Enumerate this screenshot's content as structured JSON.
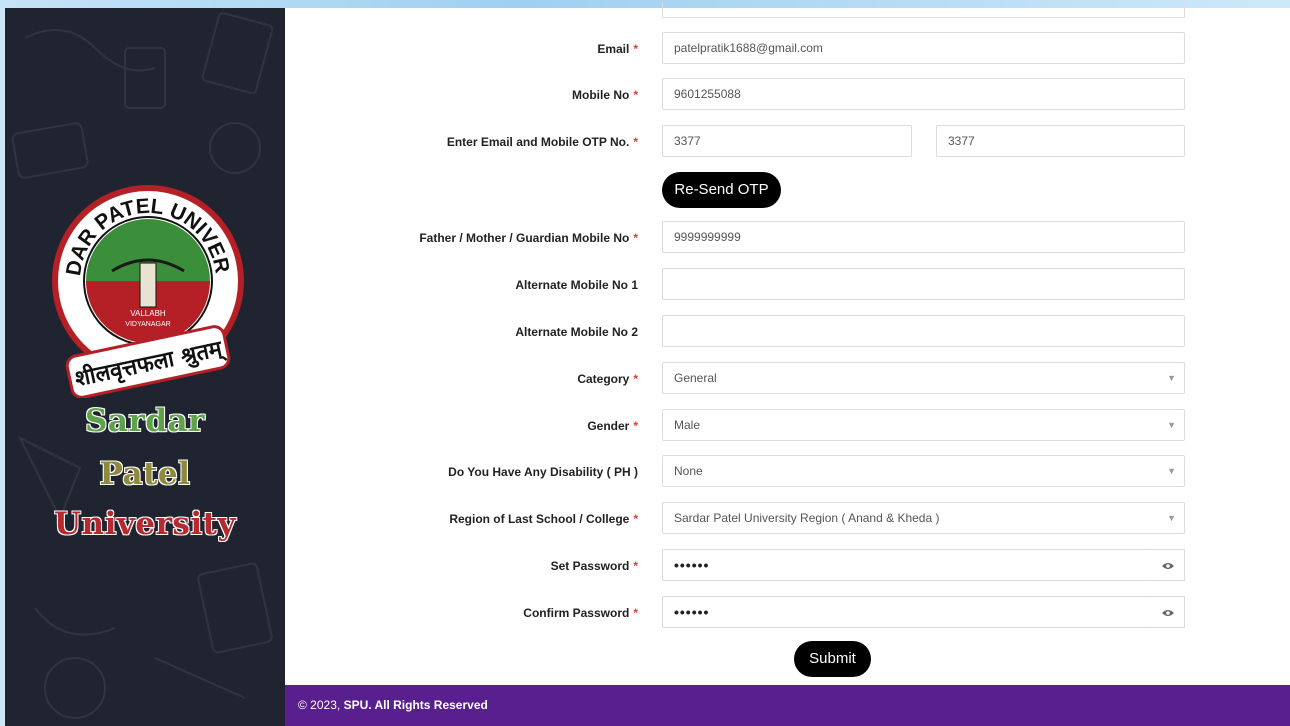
{
  "sidebar": {
    "logo_ring_text": "SARDAR PATEL UNIVERSITY",
    "logo_center_text_1": "VALLABH",
    "logo_center_text_2": "VIDYANAGAR",
    "logo_motto": "शीलवृत्तफला श्रुतम्",
    "name_line1": "Sardar",
    "name_line2": "Patel",
    "name_line3": "University"
  },
  "form": {
    "email_label": "Email",
    "email_value": "patelpratik1688@gmail.com",
    "mobile_label": "Mobile No",
    "mobile_value": "9601255088",
    "otp_label": "Enter Email and Mobile OTP No.",
    "otp_email_value": "3377",
    "otp_mobile_value": "3377",
    "resend_otp_label": "Re-Send OTP",
    "guardian_mobile_label": "Father / Mother / Guardian Mobile No",
    "guardian_mobile_value": "9999999999",
    "alt_mobile1_label": "Alternate Mobile No 1",
    "alt_mobile1_value": "",
    "alt_mobile2_label": "Alternate Mobile No 2",
    "alt_mobile2_value": "",
    "category_label": "Category",
    "category_value": "General",
    "gender_label": "Gender",
    "gender_value": "Male",
    "disability_label": "Do You Have Any Disability ( PH )",
    "disability_value": "None",
    "region_label": "Region of Last School / College",
    "region_value": "Sardar Patel University Region ( Anand & Kheda )",
    "set_password_label": "Set Password",
    "set_password_value": "••••••",
    "confirm_password_label": "Confirm Password",
    "confirm_password_value": "••••••",
    "submit_label": "Submit",
    "required_mark": "*"
  },
  "footer": {
    "copyright_prefix": "© 2023,",
    "copyright_bold": "SPU. All Rights Reserved"
  },
  "icons": {
    "eye": "eye-icon",
    "caret": "chevron-down-icon"
  },
  "colors": {
    "sidebar_bg": "#1f2430",
    "footer_bg": "#5a1f8e",
    "required": "#e53935",
    "button_bg": "#000000"
  }
}
